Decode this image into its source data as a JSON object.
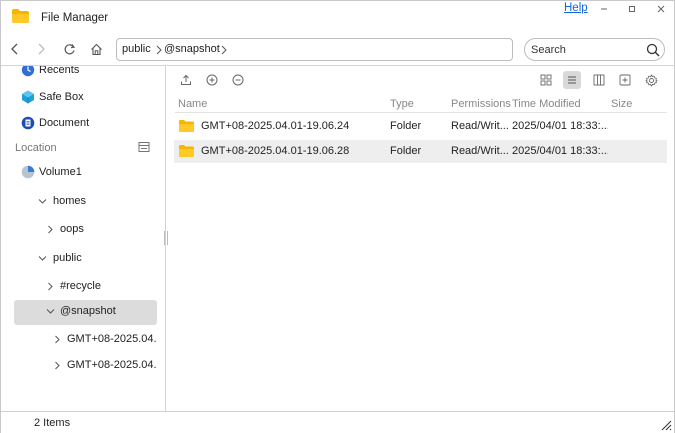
{
  "window": {
    "title": "File Manager",
    "help_label": "Help",
    "accent_color": "#1565d8",
    "folder_color": "#f7b500"
  },
  "navigation": {
    "breadcrumbs": [
      "public",
      "@snapshot"
    ],
    "search_placeholder": "Search"
  },
  "sidebar": {
    "favorites": [
      {
        "label": "Recents",
        "icon": "recents-icon"
      },
      {
        "label": "Safe Box",
        "icon": "safe-box-icon"
      },
      {
        "label": "Document",
        "icon": "document-icon"
      }
    ],
    "section_label": "Location",
    "tree": [
      {
        "label": "Volume1",
        "level": 0,
        "icon": "volume-icon"
      },
      {
        "label": "homes",
        "level": 1,
        "expanded": true
      },
      {
        "label": "oops",
        "level": 2,
        "expanded": false
      },
      {
        "label": "public",
        "level": 1,
        "expanded": true
      },
      {
        "label": "#recycle",
        "level": 2,
        "expanded": false
      },
      {
        "label": "@snapshot",
        "level": 2,
        "expanded": true,
        "selected": true
      },
      {
        "label": "GMT+08-2025.04.",
        "level": 3,
        "expanded": false
      },
      {
        "label": "GMT+08-2025.04.",
        "level": 3,
        "expanded": false
      }
    ]
  },
  "file_list": {
    "columns": [
      "Name",
      "Type",
      "Permissions",
      "Time Modified",
      "Size"
    ],
    "rows": [
      {
        "name": "GMT+08-2025.04.01-19.06.24",
        "type": "Folder",
        "permissions": "Read/Writ...",
        "modified": "2025/04/01 18:33:...",
        "size": ""
      },
      {
        "name": "GMT+08-2025.04.01-19.06.28",
        "type": "Folder",
        "permissions": "Read/Writ...",
        "modified": "2025/04/01 18:33:...",
        "size": ""
      }
    ]
  },
  "status": {
    "item_count": "2 Items"
  }
}
